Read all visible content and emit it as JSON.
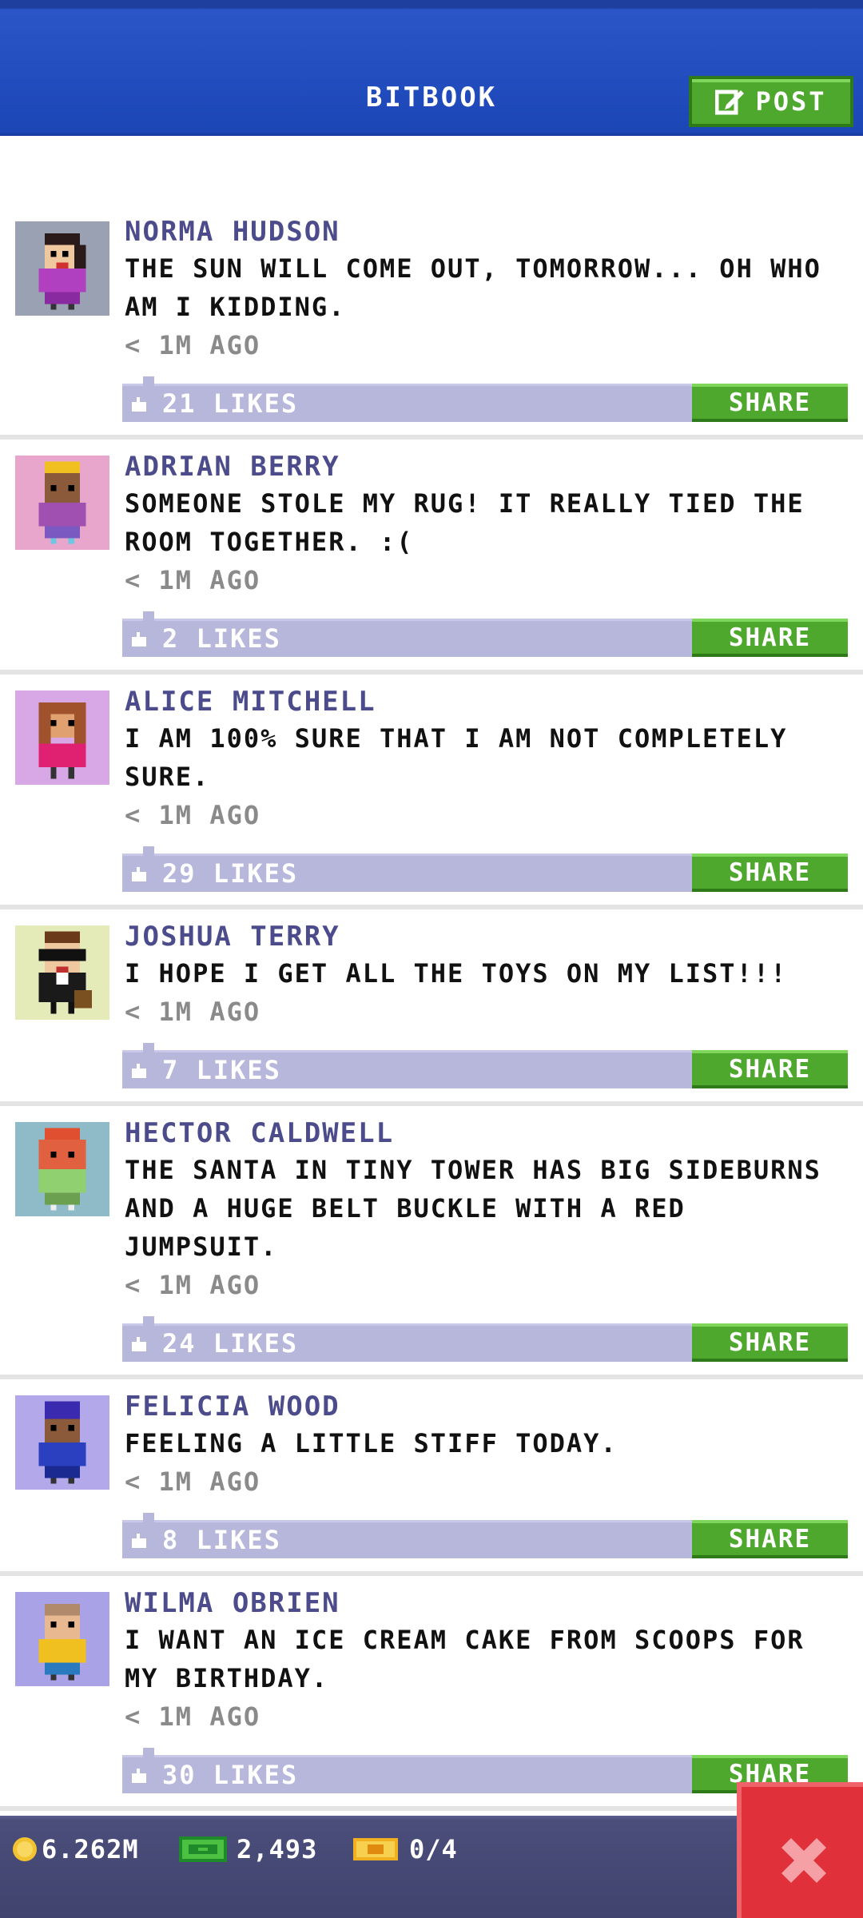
{
  "header": {
    "title": "BITBOOK",
    "post_label": "POST"
  },
  "posts": [
    {
      "author": "NORMA HUDSON",
      "message": "THE SUN WILL COME OUT, TOMORROW... OH WHO AM I KIDDING.",
      "time": "< 1M AGO",
      "likes": "21 LIKES",
      "share": "SHARE",
      "avatar_bg": "#9aa1b3",
      "avatar_icon": "norma-hudson-avatar-icon"
    },
    {
      "author": "ADRIAN BERRY",
      "message": "SOMEONE STOLE MY RUG! IT REALLY TIED THE ROOM TOGETHER. :(",
      "time": "< 1M AGO",
      "likes": "2 LIKES",
      "share": "SHARE",
      "avatar_bg": "#e8a6cc",
      "avatar_icon": "adrian-berry-avatar-icon"
    },
    {
      "author": "ALICE MITCHELL",
      "message": "I AM 100% SURE THAT I AM NOT COMPLETELY SURE.",
      "time": "< 1M AGO",
      "likes": "29 LIKES",
      "share": "SHARE",
      "avatar_bg": "#d8a8e6",
      "avatar_icon": "alice-mitchell-avatar-icon"
    },
    {
      "author": "JOSHUA TERRY",
      "message": "I HOPE I GET ALL THE TOYS ON MY LIST!!!",
      "time": "< 1M AGO",
      "likes": "7 LIKES",
      "share": "SHARE",
      "avatar_bg": "#e4eab8",
      "avatar_icon": "joshua-terry-avatar-icon"
    },
    {
      "author": "HECTOR CALDWELL",
      "message": "THE SANTA IN TINY TOWER HAS BIG SIDEBURNS AND A HUGE BELT BUCKLE WITH A RED JUMPSUIT.",
      "time": "< 1M AGO",
      "likes": "24 LIKES",
      "share": "SHARE",
      "avatar_bg": "#8fbac8",
      "avatar_icon": "hector-caldwell-avatar-icon"
    },
    {
      "author": "FELICIA WOOD",
      "message": "FEELING A LITTLE STIFF TODAY.",
      "time": "< 1M AGO",
      "likes": "8 LIKES",
      "share": "SHARE",
      "avatar_bg": "#b2a8ea",
      "avatar_icon": "felicia-wood-avatar-icon"
    },
    {
      "author": "WILMA OBRIEN",
      "message": "I WANT AN ICE CREAM CAKE FROM SCOOPS FOR MY BIRTHDAY.",
      "time": "< 1M AGO",
      "likes": "30 LIKES",
      "share": "SHARE",
      "avatar_bg": "#aaa2e6",
      "avatar_icon": "wilma-obrien-avatar-icon"
    }
  ],
  "status": {
    "coins": "6.262M",
    "bux": "2,493",
    "tickets": "0/4"
  },
  "colors": {
    "header_blue": "#1c46b6",
    "share_green": "#4ea82e",
    "like_bar": "#b7b6db",
    "author_purple": "#4c4c8c",
    "close_red": "#e0303a"
  }
}
